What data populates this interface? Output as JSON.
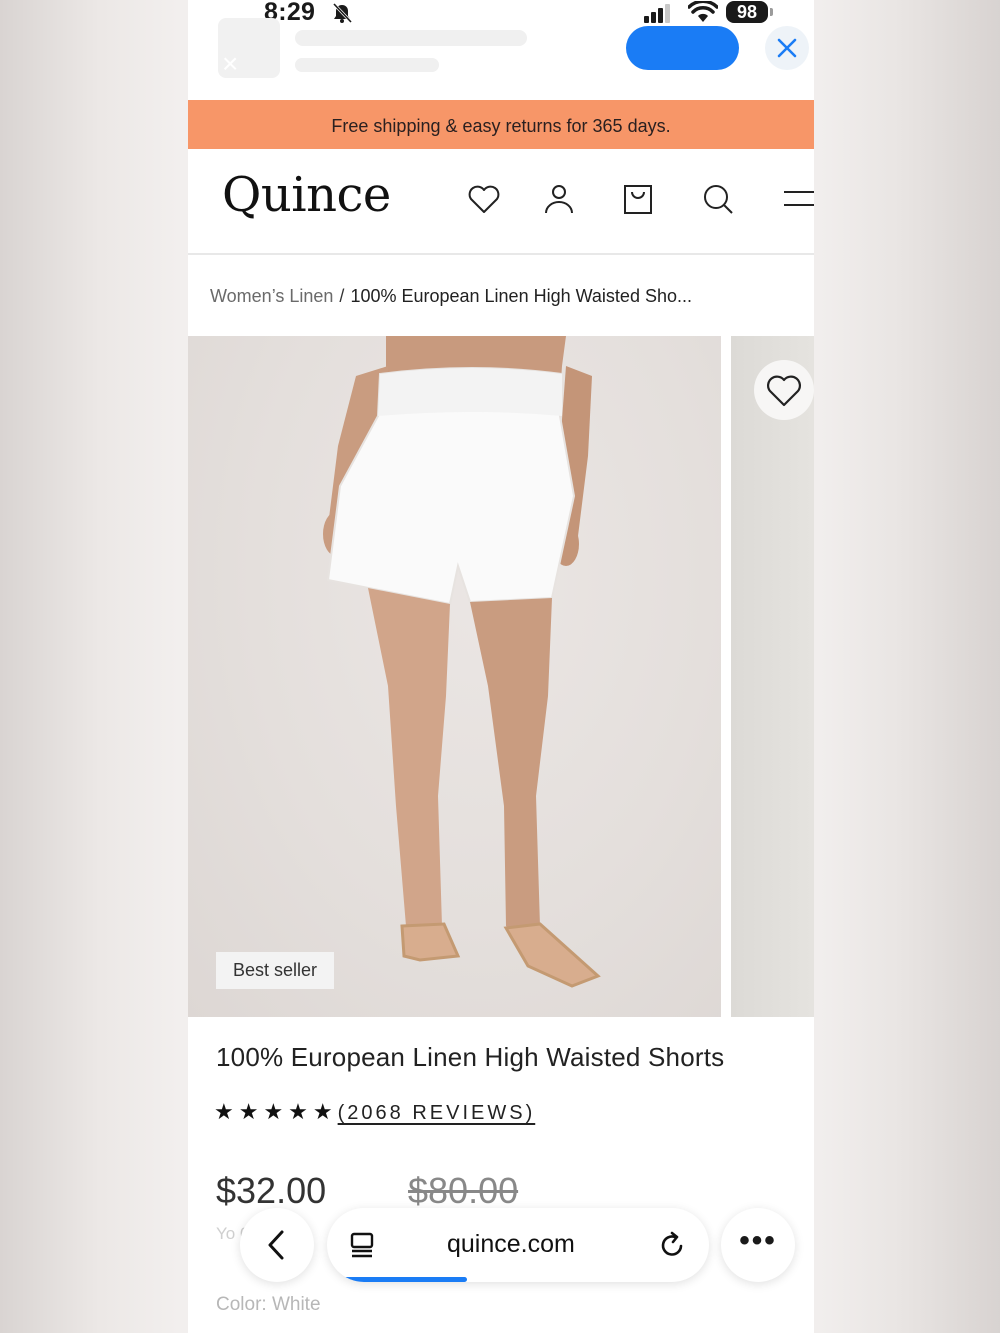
{
  "status_bar": {
    "time": "8:29",
    "battery": "98"
  },
  "promo": {
    "text": "Free shipping & easy returns for 365 days."
  },
  "header": {
    "logo": "Quince"
  },
  "breadcrumb": {
    "parent": "Women’s Linen",
    "separator": "/",
    "current": "100% European Linen High Waisted Sho..."
  },
  "gallery": {
    "badge": "Best seller"
  },
  "product": {
    "title": "100% European Linen High Waisted Shorts",
    "stars": "★★★★★",
    "rating": 5,
    "reviews": "(2068 REVIEWS)",
    "price": "$32.00",
    "compare_price": "$80.00",
    "savings_text": "Yo         0%",
    "color_label": "Color: White"
  },
  "browser": {
    "url": "quince.com",
    "more": "•••"
  },
  "colors": {
    "promo_bg": "#f79668",
    "accent_blue": "#1a7cf5"
  },
  "icons": [
    "notifications-off-icon",
    "signal-icon",
    "wifi-icon",
    "close-icon",
    "heart-icon",
    "account-icon",
    "bag-icon",
    "search-icon",
    "menu-icon",
    "back-icon",
    "tabs-icon",
    "reload-icon",
    "more-icon"
  ]
}
